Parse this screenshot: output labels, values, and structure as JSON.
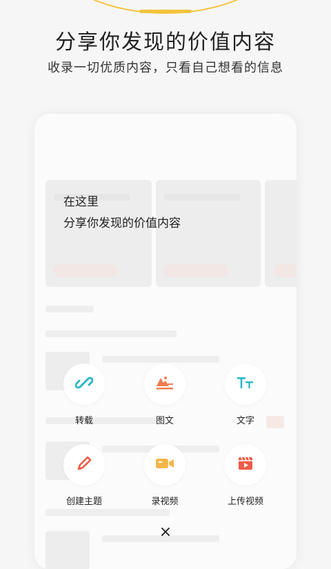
{
  "header": {
    "title": "分享你发现的价值内容",
    "subtitle": "收录一切优质内容，只看自己想看的信息"
  },
  "tooltip": {
    "line1": "在这里",
    "line2": "分享你发现的价值内容"
  },
  "actions": [
    {
      "label": "转载",
      "icon": "link-icon"
    },
    {
      "label": "图文",
      "icon": "image-text-icon"
    },
    {
      "label": "文字",
      "icon": "text-icon"
    },
    {
      "label": "创建主题",
      "icon": "pencil-icon"
    },
    {
      "label": "录视频",
      "icon": "video-camera-icon"
    },
    {
      "label": "上传视频",
      "icon": "upload-video-icon"
    }
  ],
  "close": {
    "icon": "close-icon",
    "glyph": "×"
  },
  "colors": {
    "accent": "#f3c33b",
    "teal": "#2ab7c9",
    "orange": "#f07c4f",
    "yellow_icon": "#f5b64a",
    "red": "#ef5b46"
  }
}
